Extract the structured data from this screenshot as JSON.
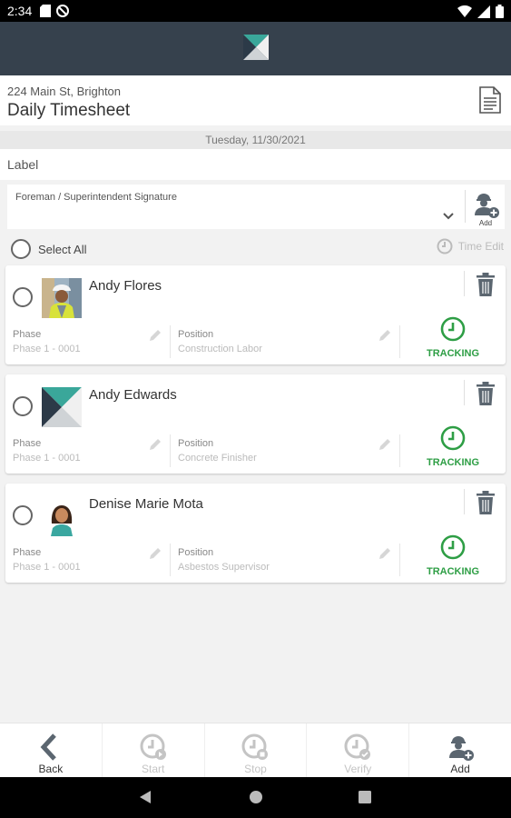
{
  "status_bar": {
    "time": "2:34",
    "icons": [
      "sd-card-icon",
      "no-sync-icon",
      "wifi-icon",
      "signal-icon",
      "battery-icon"
    ]
  },
  "app_bar": {
    "logo": "app-logo"
  },
  "job": {
    "address": "224 Main St, Brighton",
    "title": "Daily Timesheet",
    "doc_icon": "document-icon"
  },
  "date": "Tuesday, 11/30/2021",
  "label_row": {
    "text": "Label"
  },
  "signature": {
    "label": "Foreman / Superintendent Signature",
    "add_label": "Add"
  },
  "select_all": "Select All",
  "time_edit": "Time Edit",
  "employees": [
    {
      "name": "Andy Flores",
      "phase_label": "Phase",
      "phase": "Phase 1 - 0001",
      "position_label": "Position",
      "position": "Construction Labor",
      "status": "TRACKING"
    },
    {
      "name": "Andy Edwards",
      "phase_label": "Phase",
      "phase": "Phase 1 - 0001",
      "position_label": "Position",
      "position": "Concrete Finisher",
      "status": "TRACKING"
    },
    {
      "name": "Denise Marie Mota",
      "phase_label": "Phase",
      "phase": "Phase 1 - 0001",
      "position_label": "Position",
      "position": "Asbestos Supervisor",
      "status": "TRACKING"
    }
  ],
  "bottom_actions": [
    {
      "label": "Back",
      "enabled": true
    },
    {
      "label": "Start",
      "enabled": false
    },
    {
      "label": "Stop",
      "enabled": false
    },
    {
      "label": "Verify",
      "enabled": false
    },
    {
      "label": "Add",
      "enabled": true
    }
  ],
  "colors": {
    "app_bar": "#36414d",
    "tracking_green": "#2e9e45",
    "disabled": "#c4c4c4",
    "active_icon": "#5b6670"
  }
}
